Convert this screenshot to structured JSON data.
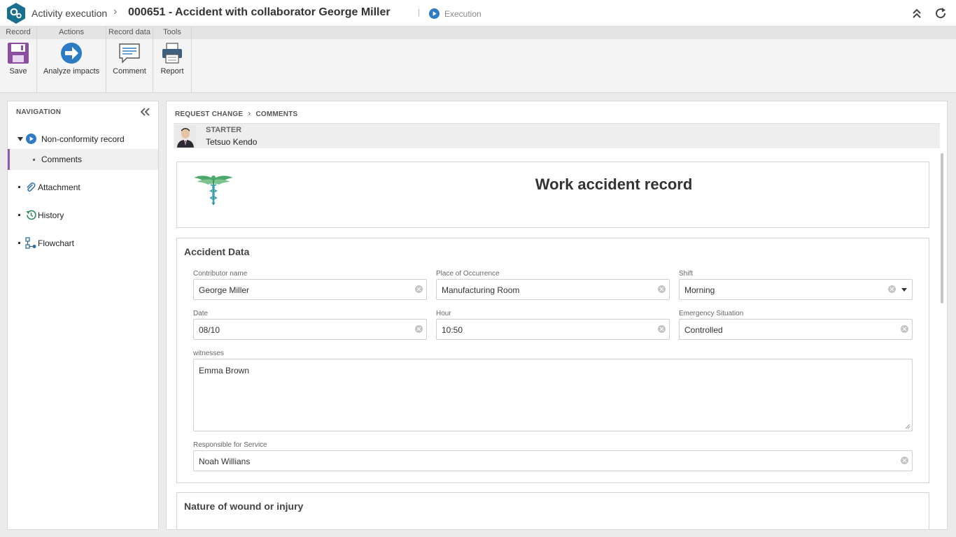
{
  "titlebar": {
    "app_name": "Activity execution",
    "separator": "›",
    "record_title": "000651 - Accident with collaborator George Miller",
    "pipe": "|",
    "status": "Execution",
    "icons": {
      "logo": "gears-icon",
      "status": "play-circle-icon",
      "collapse": "double-chevron-up-icon",
      "refresh": "refresh-icon"
    }
  },
  "ribbon": {
    "groups": [
      {
        "label": "Record",
        "buttons": [
          {
            "label": "Save",
            "icon": "floppy-disk-icon"
          }
        ]
      },
      {
        "label": "Actions",
        "buttons": [
          {
            "label": "Analyze impacts",
            "icon": "arrow-right-circle-icon"
          }
        ]
      },
      {
        "label": "Record data",
        "buttons": [
          {
            "label": "Comment",
            "icon": "comment-icon"
          }
        ]
      },
      {
        "label": "Tools",
        "buttons": [
          {
            "label": "Report",
            "icon": "printer-icon"
          }
        ]
      }
    ]
  },
  "navigation": {
    "title": "NAVIGATION",
    "items": [
      {
        "label": "Non-conformity record",
        "icon": "play-circle-icon"
      },
      {
        "label": "Comments",
        "active": true
      },
      {
        "label": "Attachment",
        "icon": "paperclip-icon"
      },
      {
        "label": "History",
        "icon": "history-icon"
      },
      {
        "label": "Flowchart",
        "icon": "flowchart-icon"
      }
    ]
  },
  "main": {
    "breadcrumb": {
      "first": "REQUEST CHANGE",
      "separator": "›",
      "second": "COMMENTS"
    },
    "starter": {
      "label": "STARTER",
      "name": "Tetsuo Kendo"
    },
    "form": {
      "title": "Work accident record",
      "logo_icon": "caduceus-icon",
      "section1": {
        "title": "Accident Data",
        "fields": {
          "contributor_name": {
            "label": "Contributor name",
            "value": "George Miller"
          },
          "place": {
            "label": "Place of Occurrence",
            "value": "Manufacturing Room"
          },
          "shift": {
            "label": "Shift",
            "value": "Morning"
          },
          "date": {
            "label": "Date",
            "value": "08/10"
          },
          "hour": {
            "label": "Hour",
            "value": "10:50"
          },
          "emergency": {
            "label": "Emergency Situation",
            "value": "Controlled"
          },
          "witnesses": {
            "label": "witnesses",
            "value": "Emma Brown"
          },
          "responsible": {
            "label": "Responsible for Service",
            "value": "Noah Willians"
          }
        }
      },
      "section2": {
        "title": "Nature of wound or injury"
      }
    }
  },
  "colors": {
    "accent_purple": "#8a5fa8",
    "accent_blue": "#2d7bc4",
    "logo_teal": "#1a6e8e"
  }
}
